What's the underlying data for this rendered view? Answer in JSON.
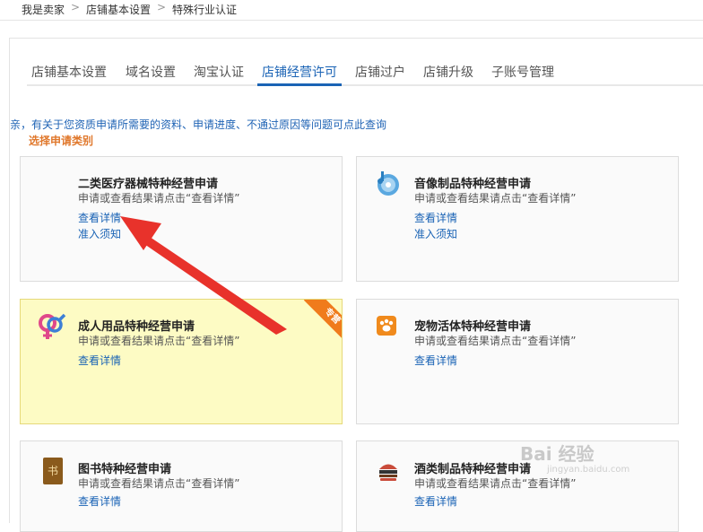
{
  "breadcrumb": {
    "items": [
      "我是卖家",
      "店铺基本设置",
      "特殊行业认证"
    ],
    "separator": ">"
  },
  "tabs": [
    {
      "label": "店铺基本设置"
    },
    {
      "label": "域名设置"
    },
    {
      "label": "淘宝认证"
    },
    {
      "label": "店铺经营许可"
    },
    {
      "label": "店铺过户"
    },
    {
      "label": "店铺升级"
    },
    {
      "label": "子账号管理"
    }
  ],
  "active_tab": "店铺经营许可",
  "notice": "亲，有关于您资质申请所需要的资料、申请进度、不通过原因等问题可点此查询",
  "section_title": "选择申请类别",
  "cards": [
    {
      "title": "二类医疗器械特种经营申请",
      "desc": "申请或查看结果请点击“查看详情”",
      "link1": "查看详情",
      "link2": "准入须知"
    },
    {
      "title": "音像制品特种经营申请",
      "desc": "申请或查看结果请点击“查看详情”",
      "link1": "查看详情",
      "link2": "准入须知"
    },
    {
      "title": "成人用品特种经营申请",
      "desc": "申请或查看结果请点击“查看详情”",
      "link1": "查看详情",
      "ribbon": "专营"
    },
    {
      "title": "宠物活体特种经营申请",
      "desc": "申请或查看结果请点击“查看详情”",
      "link1": "查看详情"
    },
    {
      "title": "图书特种经营申请",
      "desc": "申请或查看结果请点击“查看详情”",
      "link1": "查看详情",
      "icon_char": "书"
    },
    {
      "title": "酒类制品特种经营申请",
      "desc": "申请或查看结果请点击“查看详情”",
      "link1": "查看详情"
    }
  ],
  "colors": {
    "link": "#1a63b5",
    "accent_orange": "#e0782c",
    "arrow_red": "#e8322b",
    "highlight_bg": "#fdfbc4"
  },
  "watermark": {
    "main": "Bai 经验",
    "sub": "jingyan.baidu.com"
  }
}
